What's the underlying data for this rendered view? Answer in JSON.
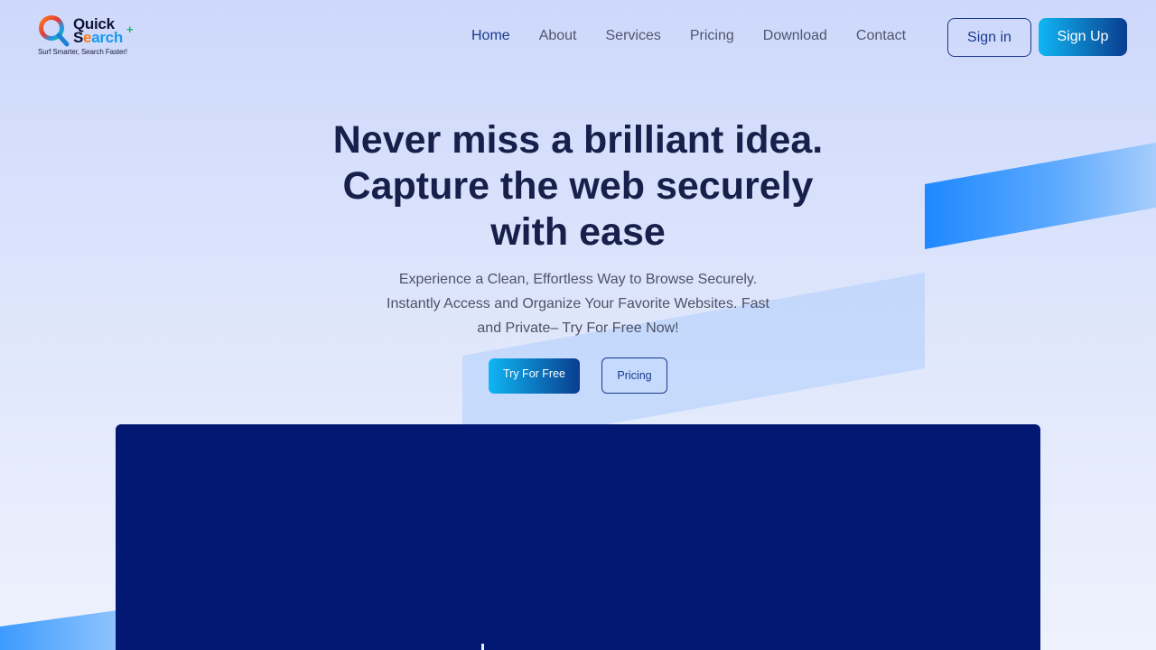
{
  "brand": {
    "name_line1": "Quick",
    "name_line2_a": "S",
    "name_line2_b": "e",
    "name_line2_c": "arch",
    "plus": "+",
    "tagline": "Surf Smarter, Search Faster!",
    "colors": {
      "dark": "#0f1433",
      "blue": "#1a9af0",
      "orange": "#ff7a1a",
      "green": "#21b573"
    }
  },
  "nav": {
    "items": [
      {
        "label": "Home",
        "active": true
      },
      {
        "label": "About",
        "active": false
      },
      {
        "label": "Services",
        "active": false
      },
      {
        "label": "Pricing",
        "active": false
      },
      {
        "label": "Download",
        "active": false
      },
      {
        "label": "Contact",
        "active": false
      }
    ],
    "signin_label": "Sign in",
    "signup_label": "Sign Up"
  },
  "hero": {
    "title_line1": "Never miss a brilliant idea.",
    "title_line2": "Capture the web securely",
    "title_line3": "with ease",
    "subtitle_line1": "Experience a Clean, Effortless Way to Browse Securely.",
    "subtitle_line2": "Instantly Access and Organize Your Favorite Websites. Fast",
    "subtitle_line3": "and Private– Try For Free Now!",
    "cta_primary": "Try For Free",
    "cta_secondary": "Pricing"
  },
  "theme": {
    "accent_start": "#0fb6f3",
    "accent_end": "#0a3d8f",
    "heading": "#16204a",
    "panel": "#021873"
  }
}
